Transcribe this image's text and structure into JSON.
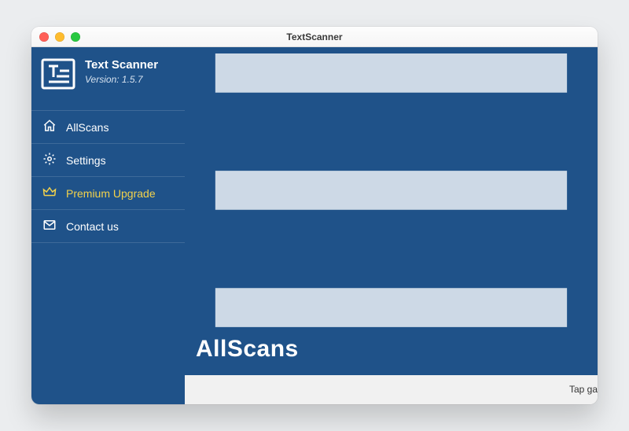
{
  "window": {
    "title": "TextScanner"
  },
  "brand": {
    "name": "Text Scanner",
    "version_label": "Version: 1.5.7"
  },
  "sidebar": {
    "items": [
      {
        "label": "AllScans"
      },
      {
        "label": "Settings"
      },
      {
        "label": "Premium Upgrade"
      },
      {
        "label": "Contact us"
      }
    ]
  },
  "main": {
    "page_title": "AllScans",
    "tap_hint": "Tap ga"
  },
  "colors": {
    "primary": "#1f5289",
    "premium": "#f3d24b"
  }
}
